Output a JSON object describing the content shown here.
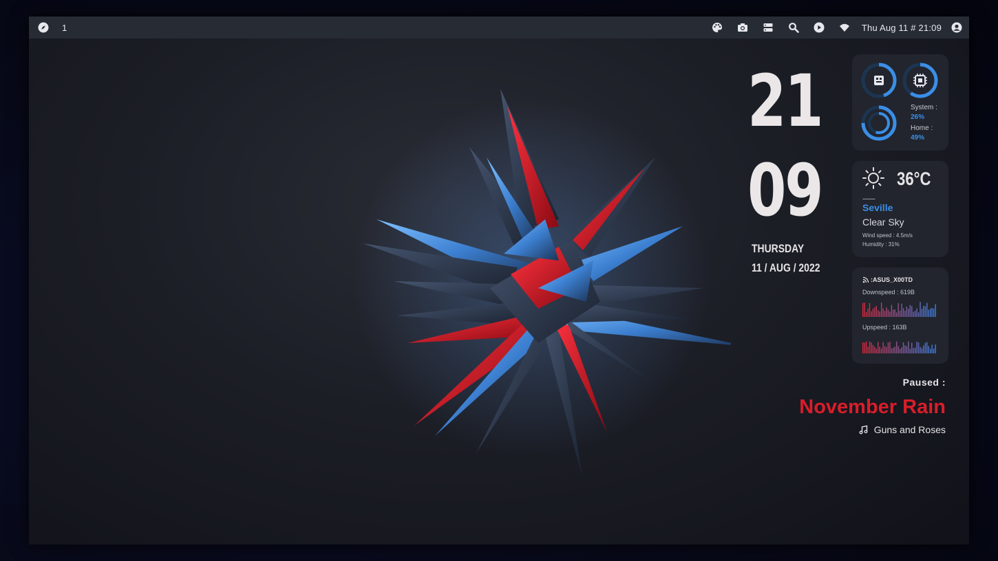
{
  "topbar": {
    "workspace": "1",
    "clock": "Thu Aug 11 # 21:09",
    "icons": [
      "compass-icon",
      "palette-icon",
      "camera-icon",
      "server-icon",
      "search-icon",
      "play-icon",
      "wifi-icon",
      "user-icon"
    ]
  },
  "clock": {
    "hour": "21",
    "minute": "09",
    "day": "THURSDAY",
    "date": "11 / AUG / 2022"
  },
  "system": {
    "system_label": "System :",
    "system_value": "26%",
    "home_label": "Home :",
    "home_value": "49%",
    "ram_fraction": 0.45,
    "cpu_fraction": 0.6,
    "disk_fraction": 0.35,
    "accent": "#3a8ee6"
  },
  "weather": {
    "temp": "36°C",
    "dots": "............",
    "city": "Seville",
    "desc": "Clear Sky",
    "wind": "Wind speed : 4.5m/s",
    "humidity": "Humidity : 31%"
  },
  "network": {
    "ssid": ":ASUS_X00TD",
    "down": "Downspeed : 619B",
    "up": "Upspeed : 163B"
  },
  "music": {
    "status": "Paused :",
    "title": "November Rain",
    "artist": "Guns and Roses",
    "title_color": "#d81e2a"
  }
}
